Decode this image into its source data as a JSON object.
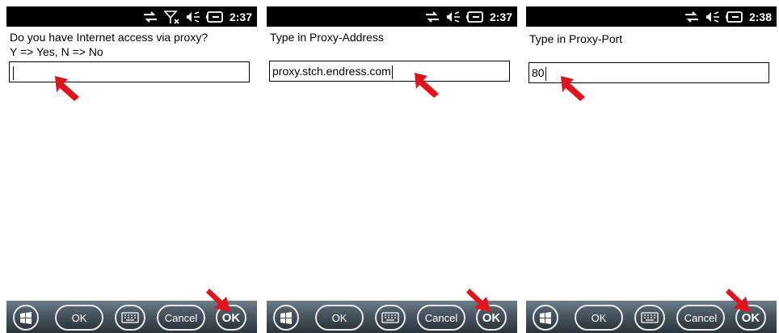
{
  "screens": [
    {
      "status": {
        "time": "2:37",
        "icons": [
          "sync-icon",
          "no-signal-icon",
          "volume-muted-icon",
          "battery-charging-icon"
        ]
      },
      "prompt": [
        "Do you have Internet access via proxy?",
        "Y => Yes, N => No"
      ],
      "input": {
        "value": ""
      },
      "softkeys": {
        "ok": "OK",
        "cancel": "Cancel",
        "confirm": "OK"
      }
    },
    {
      "status": {
        "time": "2:37",
        "icons": [
          "sync-icon",
          "volume-muted-icon",
          "battery-charging-icon"
        ]
      },
      "prompt": [
        "Type in Proxy-Address"
      ],
      "input": {
        "value": "proxy.stch.endress.com"
      },
      "softkeys": {
        "ok": "OK",
        "cancel": "Cancel",
        "confirm": "OK"
      }
    },
    {
      "status": {
        "time": "2:38",
        "icons": [
          "sync-icon",
          "volume-muted-icon",
          "battery-charging-icon"
        ]
      },
      "prompt": [
        "Type in Proxy-Port"
      ],
      "input": {
        "value": "80"
      },
      "softkeys": {
        "ok": "OK",
        "cancel": "Cancel",
        "confirm": "OK"
      }
    }
  ],
  "colors": {
    "statusbar": "#000000",
    "softbar": "#3a4650",
    "annotation_arrow": "#e0141c"
  }
}
